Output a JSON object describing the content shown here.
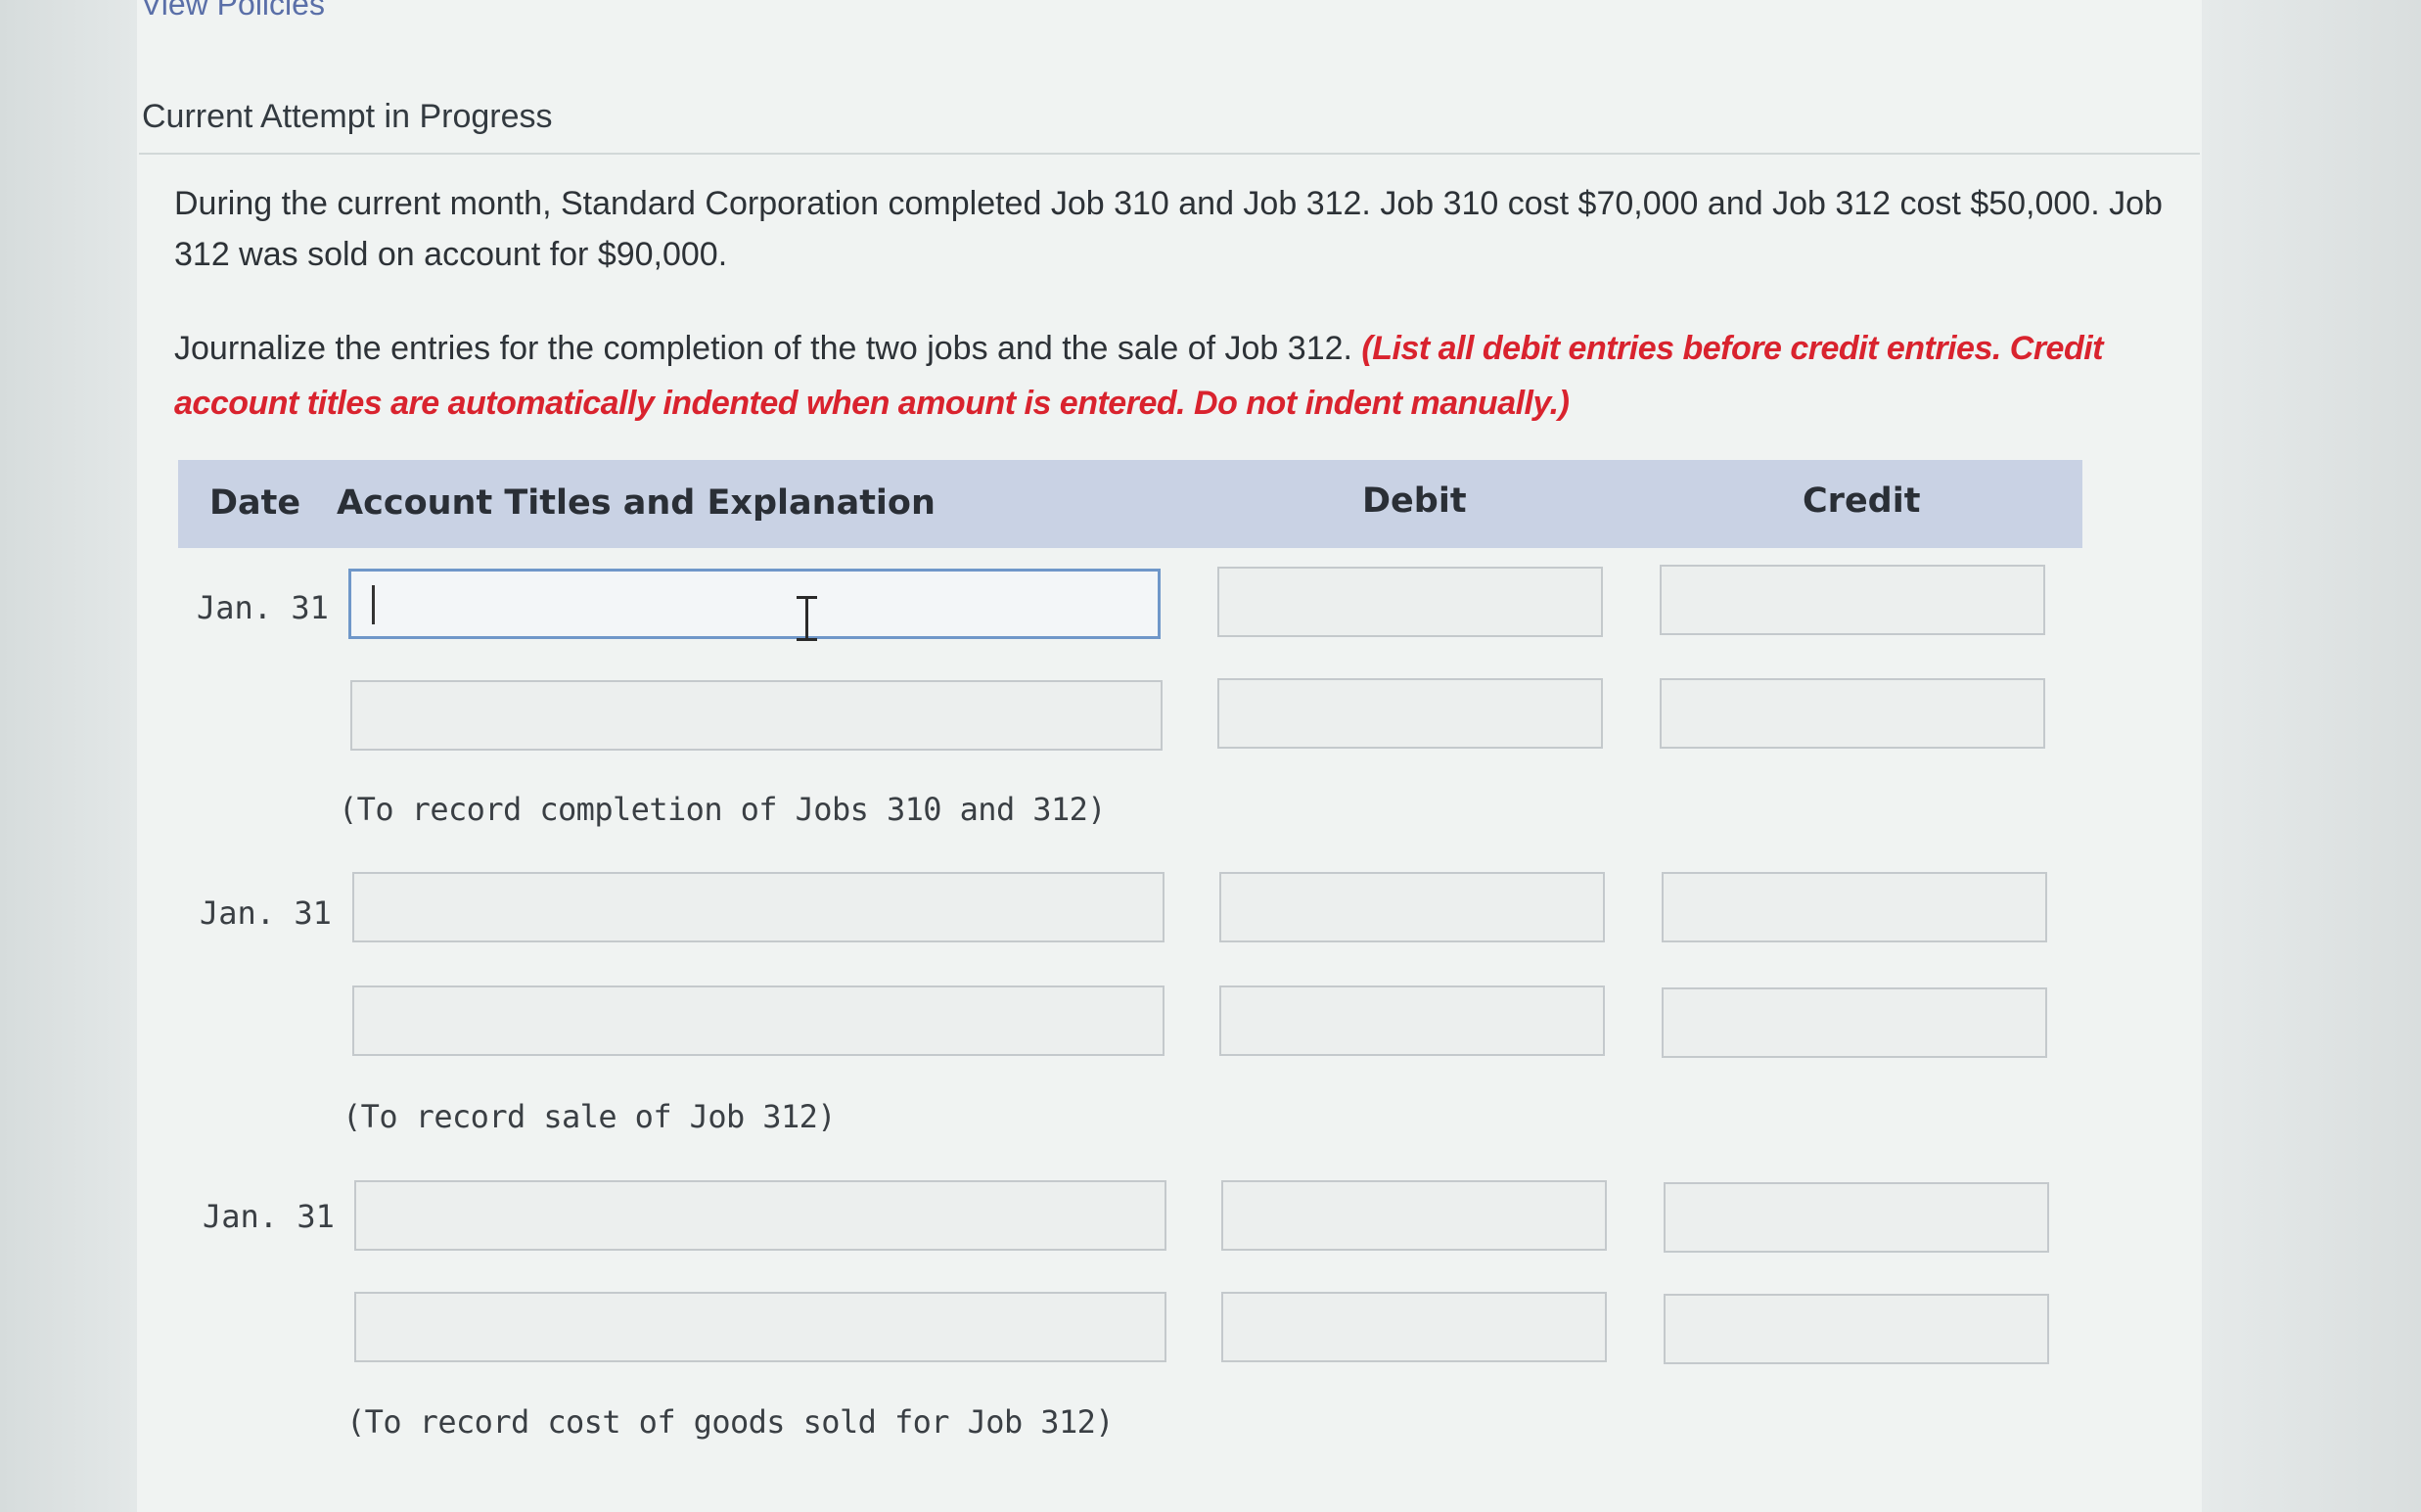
{
  "header": {
    "link_label": "View Policies",
    "attempt_title": "Current Attempt in Progress"
  },
  "problem": {
    "text": "During the current month, Standard Corporation completed Job 310 and Job 312. Job 310 cost $70,000 and Job 312 cost $50,000. Job 312 was sold on account for $90,000.",
    "instruction": "Journalize the entries for the completion of the two jobs and the sale of Job 312.",
    "instruction_note": "(List all debit entries before credit entries. Credit account titles are automatically indented when amount is entered. Do not indent manually.)"
  },
  "table": {
    "headers": {
      "date": "Date",
      "account": "Account Titles and Explanation",
      "debit": "Debit",
      "credit": "Credit"
    },
    "entries": [
      {
        "date": "Jan. 31",
        "explanation": "(To record completion of Jobs 310 and 312)",
        "rows": [
          {
            "account": "",
            "debit": "",
            "credit": ""
          },
          {
            "account": "",
            "debit": "",
            "credit": ""
          }
        ]
      },
      {
        "date": "Jan. 31",
        "explanation": "(To record sale of Job 312)",
        "rows": [
          {
            "account": "",
            "debit": "",
            "credit": ""
          },
          {
            "account": "",
            "debit": "",
            "credit": ""
          }
        ]
      },
      {
        "date": "Jan. 31",
        "explanation": "(To record cost of goods sold for Job 312)",
        "rows": [
          {
            "account": "",
            "debit": "",
            "credit": ""
          },
          {
            "account": "",
            "debit": "",
            "credit": ""
          }
        ]
      }
    ]
  }
}
